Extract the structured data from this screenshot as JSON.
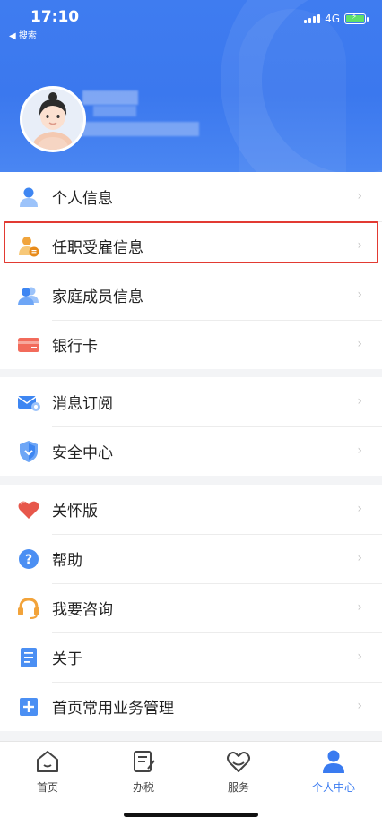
{
  "status_bar": {
    "time": "17:10",
    "back_label": "◀ 搜索",
    "network": "4G"
  },
  "menu": {
    "group1": [
      {
        "label": "个人信息",
        "icon": "person-icon"
      },
      {
        "label": "任职受雇信息",
        "icon": "employment-person-icon"
      },
      {
        "label": "家庭成员信息",
        "icon": "family-members-icon"
      },
      {
        "label": "银行卡",
        "icon": "bank-card-icon"
      }
    ],
    "group2": [
      {
        "label": "消息订阅",
        "icon": "mail-settings-icon"
      },
      {
        "label": "安全中心",
        "icon": "shield-icon"
      }
    ],
    "group3": [
      {
        "label": "关怀版",
        "icon": "heart-icon"
      },
      {
        "label": "帮助",
        "icon": "question-icon"
      },
      {
        "label": "我要咨询",
        "icon": "headset-icon"
      },
      {
        "label": "关于",
        "icon": "document-icon"
      },
      {
        "label": "首页常用业务管理",
        "icon": "plus-square-icon"
      }
    ]
  },
  "tabbar": [
    {
      "label": "首页",
      "icon": "home-icon"
    },
    {
      "label": "办税",
      "icon": "tax-form-icon"
    },
    {
      "label": "服务",
      "icon": "heart-hands-icon"
    },
    {
      "label": "个人中心",
      "icon": "person-center-icon",
      "active": true
    }
  ],
  "colors": {
    "header_blue": "#3f7cf0",
    "active_tab": "#3a7bf0",
    "highlight": "#e23a32"
  }
}
